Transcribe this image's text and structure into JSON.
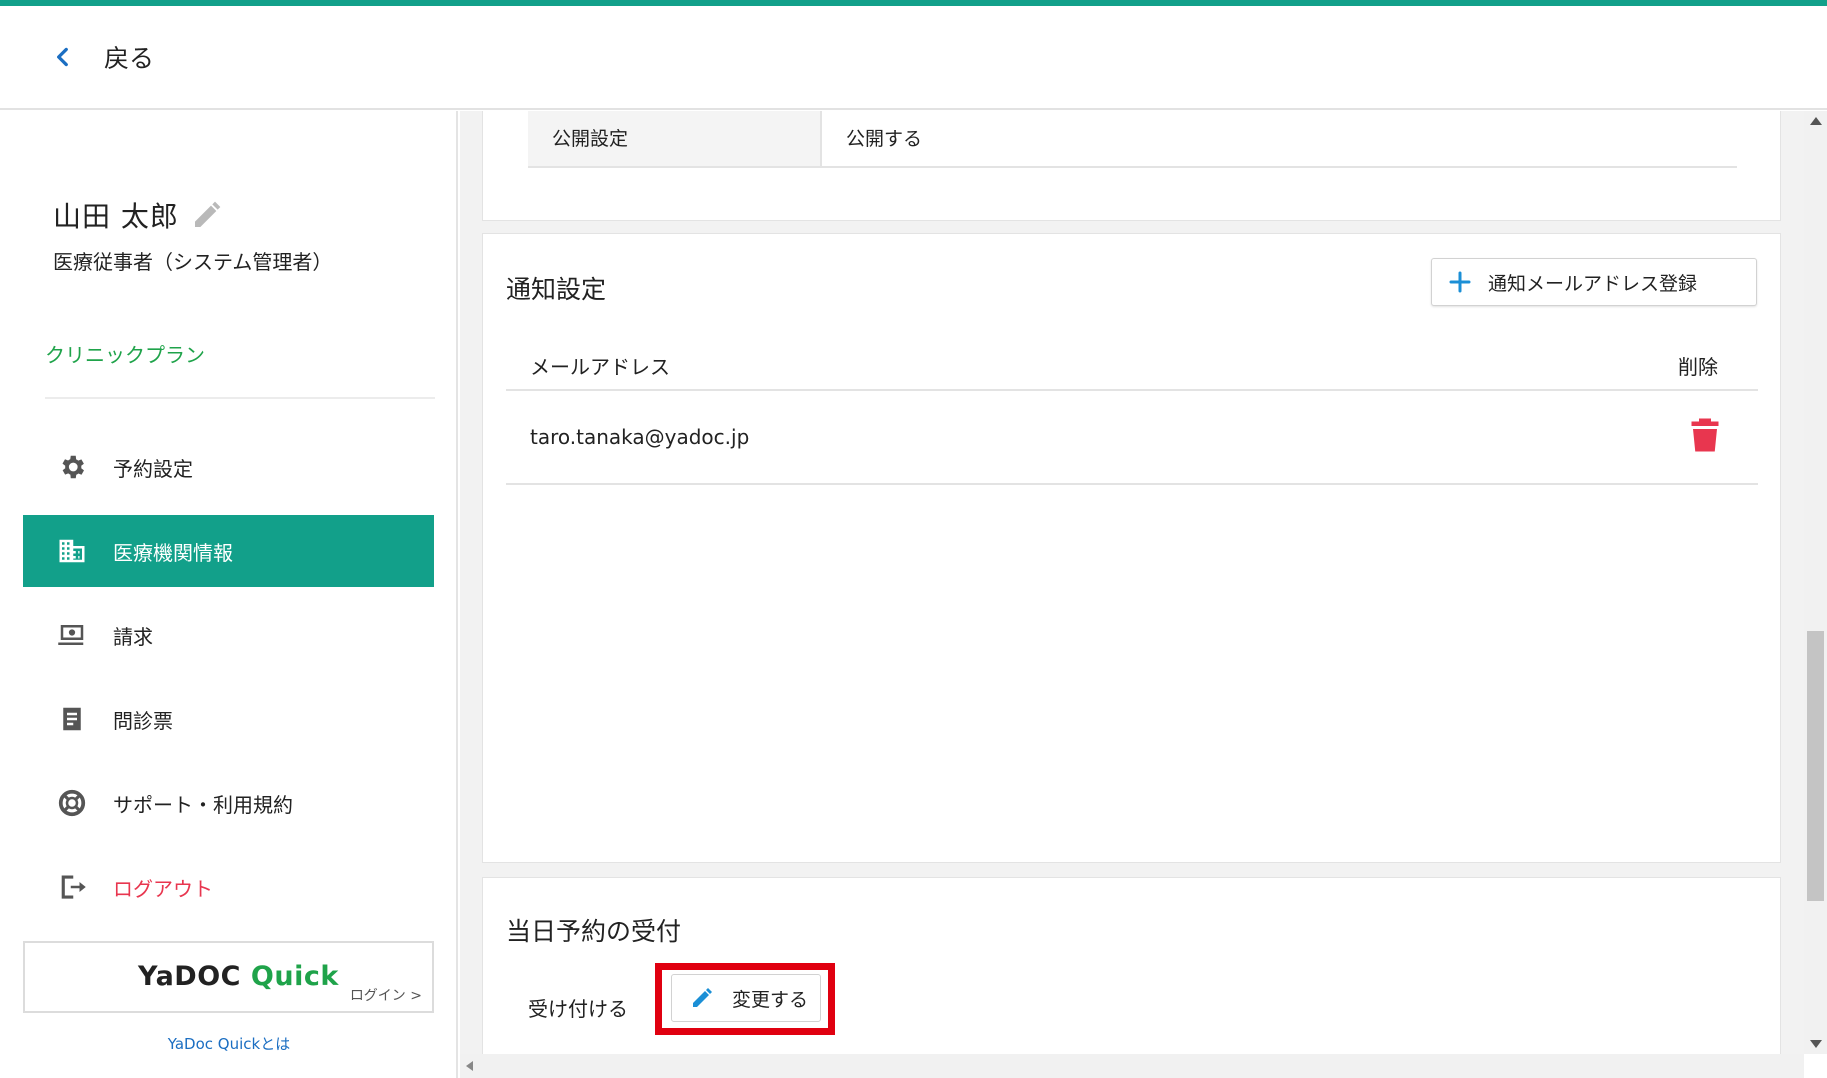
{
  "header": {
    "back_label": "戻る",
    "accent_color": "#12a08a"
  },
  "user": {
    "name": "山田 太郎",
    "role": "医療従事者（システム管理者）",
    "plan": "クリニックプラン"
  },
  "sidebar": {
    "items": [
      {
        "label": "予約設定",
        "icon": "gear-icon",
        "active": false
      },
      {
        "label": "医療機関情報",
        "icon": "building-icon",
        "active": true
      },
      {
        "label": "請求",
        "icon": "billing-icon",
        "active": false
      },
      {
        "label": "問診票",
        "icon": "clipboard-icon",
        "active": false
      },
      {
        "label": "サポート・利用規約",
        "icon": "lifebuoy-icon",
        "active": false
      },
      {
        "label": "ログアウト",
        "icon": "logout-icon",
        "active": false
      }
    ]
  },
  "quick": {
    "logo_part1": "YaDOC",
    "logo_part2": "Quick",
    "login_label": "ログイン >",
    "about_link": "YaDoc Quickとは"
  },
  "publish": {
    "label": "公開設定",
    "value": "公開する"
  },
  "notify": {
    "title": "通知設定",
    "add_button_label": "通知メールアドレス登録",
    "columns": {
      "email": "メールアドレス",
      "delete": "削除"
    },
    "rows": [
      {
        "email": "taro.tanaka@yadoc.jp"
      }
    ]
  },
  "sameday": {
    "title": "当日予約の受付",
    "status": "受け付ける",
    "change_button_label": "変更する"
  },
  "colors": {
    "accent": "#12a08a",
    "plan_green": "#1fa34a",
    "danger": "#e8364f",
    "highlight": "#e00010",
    "link_blue": "#1b6ec2"
  }
}
